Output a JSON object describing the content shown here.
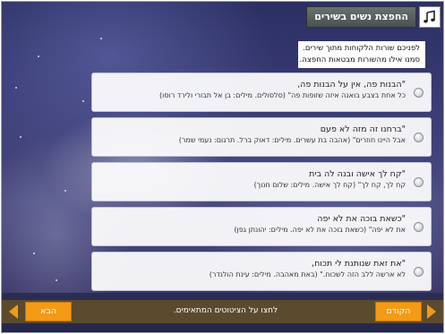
{
  "header": {
    "title": "החפצת נשים בשירים",
    "icon": "music-note-icon"
  },
  "instructions": {
    "line1": "לפניכם שורות הלקוחות מתוך שירים.",
    "line2": "סמנו אילו מהשורות מבטאות החפצה."
  },
  "options": [
    {
      "line1": "\"הבנות פה, אין על הבנות פה,",
      "line2": "כל אחת בצבע בואנה איזה שזופות פה\" (סלסולים. מילים: בן אל תבורי ולירד רוסו)"
    },
    {
      "line1": "\"ברחנו זה מזה לא פעם",
      "line2": "אבל היינו חוזרים\" (אהבה בת עשרים. מילים: דאוק ברל. תרגום: נעמי שמר)"
    },
    {
      "line1": "\"קח לך אישה ובנה לה בית",
      "line2": "קח לך, קח לך\" (קח לך אישה. מילים: שלום חנוך)"
    },
    {
      "line1": "\"כשאת בוכה את לא יפה",
      "line2": "את לא יפה\" (כשאת בוכה את לא יפה. מילים: יהונתן גפן)"
    },
    {
      "line1": "\"את זאת שנותנת לי תכוח,",
      "line2": "לא ארשה ללב הזה לשכוח.\" (באת מאהבה. מילים: עינת הולנדר)"
    }
  ],
  "footer": {
    "next_label": "הבא",
    "prev_label": "הקודם",
    "message": "לחצו על הציטוטים המתאימים."
  },
  "colors": {
    "accent": "#f39a16",
    "footer_strip": "#5c4a2e",
    "title_plate": "#4b5050"
  }
}
